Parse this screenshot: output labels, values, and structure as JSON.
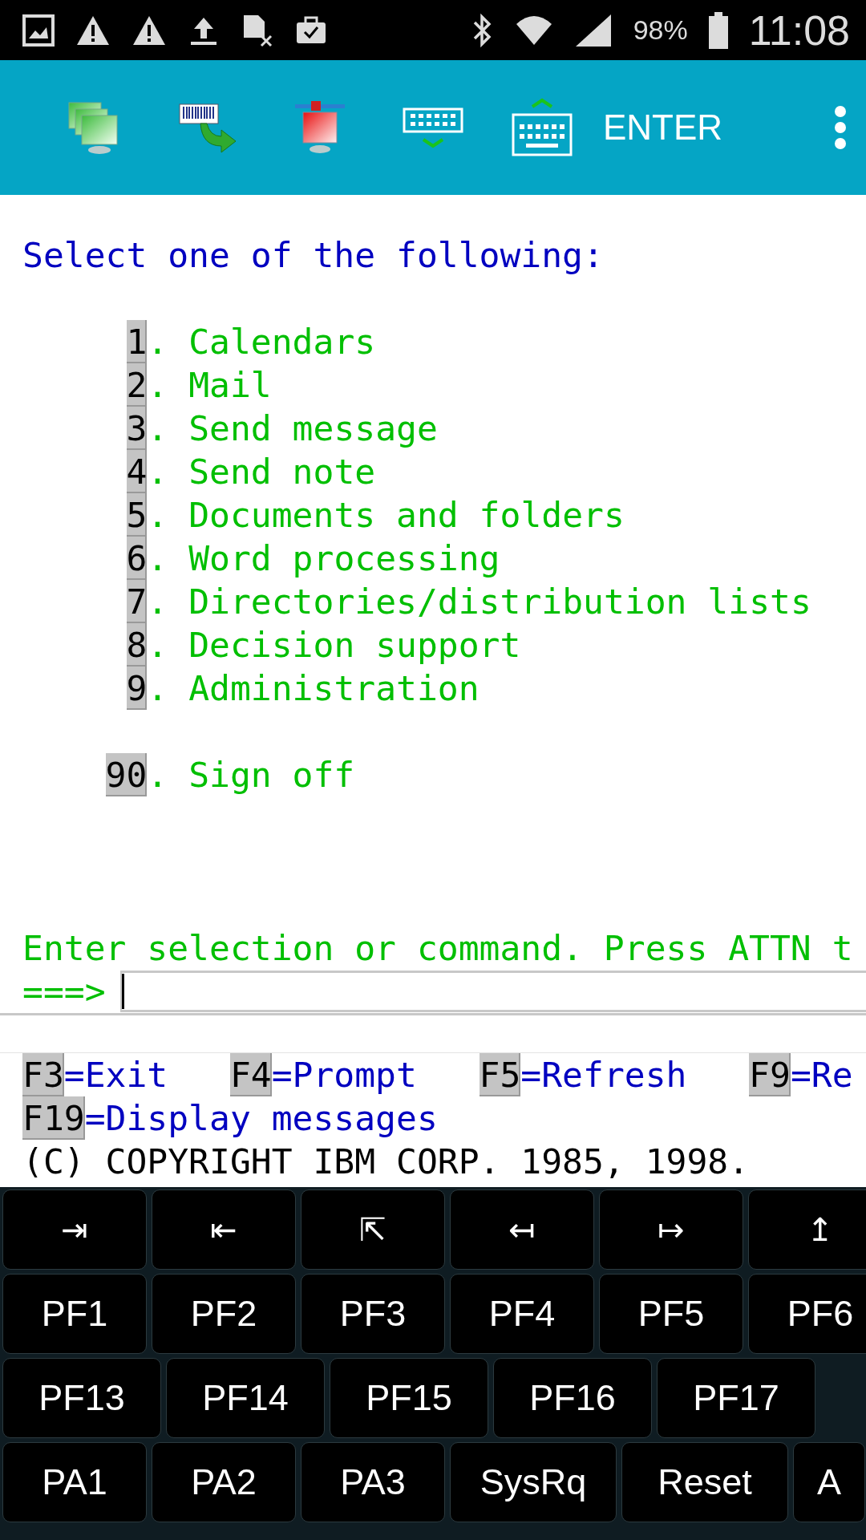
{
  "status_bar": {
    "battery": "98%",
    "time": "11:08"
  },
  "toolbar": {
    "enter_button": "ENTER"
  },
  "screen": {
    "title": "Select one of the following:",
    "options": [
      {
        "number": "1",
        "label": ". Calendars"
      },
      {
        "number": "2",
        "label": ". Mail"
      },
      {
        "number": "3",
        "label": ". Send message"
      },
      {
        "number": "4",
        "label": ". Send note"
      },
      {
        "number": "5",
        "label": ". Documents and folders"
      },
      {
        "number": "6",
        "label": ". Word processing"
      },
      {
        "number": "7",
        "label": ". Directories/distribution lists"
      },
      {
        "number": "8",
        "label": ". Decision support"
      },
      {
        "number": "9",
        "label": ". Administration"
      }
    ],
    "sign_off": {
      "number": "90",
      "label": ". Sign off"
    },
    "prompt": "Enter selection or command. Press ATTN t",
    "command": {
      "arrow": "===>"
    },
    "function_keys": [
      [
        {
          "key": "F3",
          "label": "=Exit"
        },
        {
          "key": "F4",
          "label": "=Prompt"
        },
        {
          "key": "F5",
          "label": "=Refresh"
        },
        {
          "key": "F9",
          "label": "=Re"
        }
      ],
      [
        {
          "key": "F19",
          "label": "=Display messages"
        }
      ]
    ],
    "copyright": "(C) COPYRIGHT IBM CORP. 1985, 1998."
  },
  "keyboard": {
    "rows": [
      {
        "kind": "symbols",
        "keys": [
          {
            "label": "⇥"
          },
          {
            "label": "⇤"
          },
          {
            "label": "⇱"
          },
          {
            "label": "↤"
          },
          {
            "label": "↦"
          },
          {
            "label": "↥"
          }
        ]
      },
      {
        "kind": "standard",
        "keys": [
          {
            "label": "PF1"
          },
          {
            "label": "PF2"
          },
          {
            "label": "PF3"
          },
          {
            "label": "PF4"
          },
          {
            "label": "PF5"
          },
          {
            "label": "PF6"
          }
        ]
      },
      {
        "kind": "wide",
        "keys": [
          {
            "label": "PF13"
          },
          {
            "label": "PF14"
          },
          {
            "label": "PF15"
          },
          {
            "label": "PF16"
          },
          {
            "label": "PF17"
          }
        ]
      },
      {
        "kind": "mixed",
        "keys": [
          {
            "label": "PA1"
          },
          {
            "label": "PA2"
          },
          {
            "label": "PA3"
          },
          {
            "label": "SysRq",
            "kind": "wide"
          },
          {
            "label": "Reset",
            "kind": "wide"
          },
          {
            "label": "A",
            "kind": "cut"
          }
        ]
      }
    ]
  }
}
